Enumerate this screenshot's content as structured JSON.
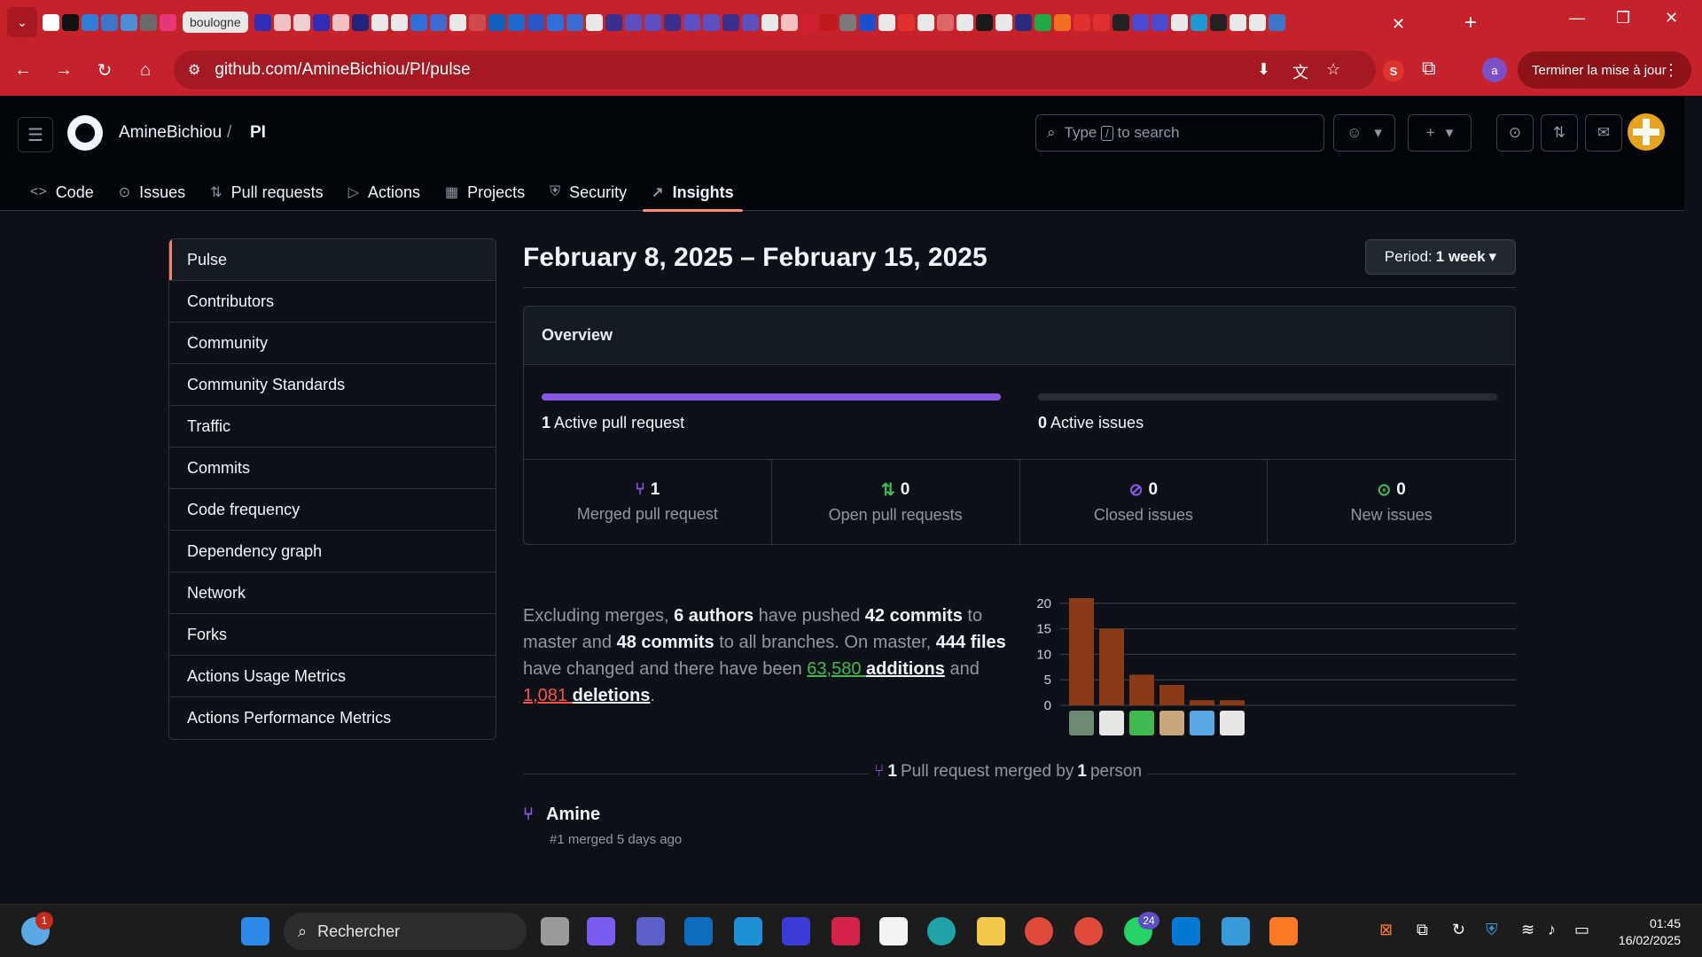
{
  "browser": {
    "tab_pill_label": "boulogne",
    "url": "github.com/AmineBichiou/PI/pulse",
    "update_button": "Terminer la mise à jour",
    "profile_initial": "a",
    "ext_s_label": "S"
  },
  "github": {
    "owner": "AmineBichiou",
    "separator": "/",
    "repo": "PI",
    "search_placeholder_before": "Type",
    "search_key": "/",
    "search_placeholder_after": "to search",
    "nav": [
      {
        "label": "Code",
        "icon": "code-icon"
      },
      {
        "label": "Issues",
        "icon": "issue-icon"
      },
      {
        "label": "Pull requests",
        "icon": "pull-request-icon"
      },
      {
        "label": "Actions",
        "icon": "play-icon"
      },
      {
        "label": "Projects",
        "icon": "table-icon"
      },
      {
        "label": "Security",
        "icon": "shield-icon"
      },
      {
        "label": "Insights",
        "icon": "graph-icon"
      }
    ]
  },
  "side_menu": [
    "Pulse",
    "Contributors",
    "Community",
    "Community Standards",
    "Traffic",
    "Commits",
    "Code frequency",
    "Dependency graph",
    "Network",
    "Forks",
    "Actions Usage Metrics",
    "Actions Performance Metrics"
  ],
  "main": {
    "title": "February 8, 2025 – February 15, 2025",
    "period_label": "Period:",
    "period_value": "1 week",
    "overview_title": "Overview",
    "active_pr_count": "1",
    "active_pr_label": "Active pull request",
    "active_pr_fill": 1.0,
    "active_issues_count": "0",
    "active_issues_label": "Active issues",
    "active_issues_fill": 0.0,
    "stats": [
      {
        "num": "1",
        "label": "Merged pull request",
        "color": "#8957e5"
      },
      {
        "num": "0",
        "label": "Open pull requests",
        "color": "#3fb950"
      },
      {
        "num": "0",
        "label": "Closed issues",
        "color": "#8957e5"
      },
      {
        "num": "0",
        "label": "New issues",
        "color": "#3fb950"
      }
    ],
    "summary": {
      "t1": "Excluding merges, ",
      "authors": "6 authors",
      "t2": " have pushed ",
      "commits_master": "42 commits",
      "t3": " to master and ",
      "commits_all": "48 commits",
      "t4": " to all branches. On master, ",
      "files": "444 files",
      "t5": " have changed and there have been ",
      "additions_num": "63,580",
      "additions_word": "additions",
      "t6": " and ",
      "deletions_num": "1,081",
      "deletions_word": "deletions",
      "t7": "."
    },
    "merged_count": "1",
    "merged_text": "Pull request merged by",
    "merged_people": "1",
    "merged_person_word": "person",
    "pr_author": "Amine",
    "pr_meta": "#1 merged 5 days ago"
  },
  "chart_data": {
    "type": "bar",
    "categories": [
      "author-1",
      "author-2",
      "author-3",
      "author-4",
      "author-5",
      "author-6"
    ],
    "values": [
      21,
      15,
      6,
      4,
      1,
      1
    ],
    "yticks": [
      0,
      5,
      10,
      15,
      20
    ],
    "ylim": [
      0,
      21
    ],
    "bar_color": "#8a3a14"
  },
  "taskbar": {
    "search_label": "Rechercher",
    "time": "01:45",
    "date": "16/02/2025",
    "whatsapp_badge": "24",
    "weather_badge": "1"
  }
}
